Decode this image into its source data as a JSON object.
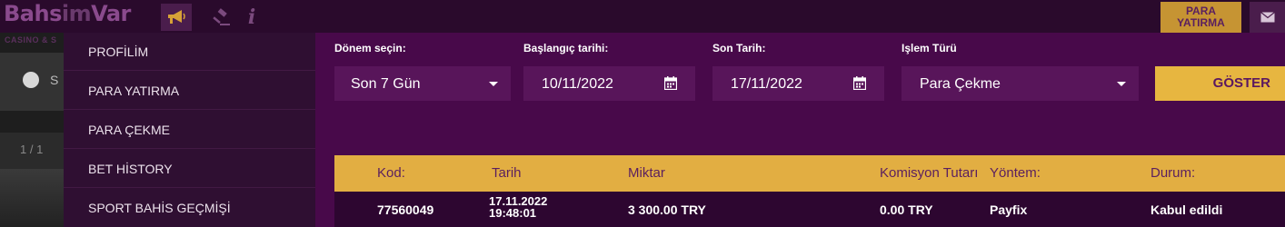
{
  "header": {
    "logo_part1": "Bahs",
    "logo_part2": "im",
    "logo_part3": "Var",
    "logo_sub": "CASINO & S",
    "deposit_button": [
      "PARA",
      "YATIRMA"
    ],
    "info_glyph": "i"
  },
  "background": {
    "tab_letter": "S",
    "pager": "1 / 1"
  },
  "menu": {
    "items": [
      "PROFİLİM",
      "PARA YATIRMA",
      "PARA ÇEKME",
      "BET HİSTORY",
      "SPORT BAHİS GEÇMİŞİ"
    ]
  },
  "filters": {
    "period_label": "Dönem seçin:",
    "period_value": "Son 7 Gün",
    "start_label": "Başlangıç tarihi:",
    "start_value": "10/11/2022",
    "end_label": "Son Tarih:",
    "end_value": "17/11/2022",
    "type_label": "Işlem Türü",
    "type_value": "Para Çekme",
    "show_button": "GÖSTER"
  },
  "table": {
    "headers": [
      "Kod:",
      "Tarih",
      "Miktar",
      "Komisyon Tutarı",
      "Yöntem:",
      "Durum:"
    ],
    "rows": [
      {
        "kod": "77560049",
        "tarih_date": "17.11.2022",
        "tarih_time": "19:48:01",
        "miktar": "3 300.00 TRY",
        "komisyon": "0.00 TRY",
        "yontem": "Payfix",
        "durum": "Kabul edildi"
      }
    ]
  },
  "colors": {
    "main_bg": "#48094a",
    "menu_bg": "#2f0f32",
    "accent": "#e7b640",
    "table_header": "#e2ae42"
  }
}
